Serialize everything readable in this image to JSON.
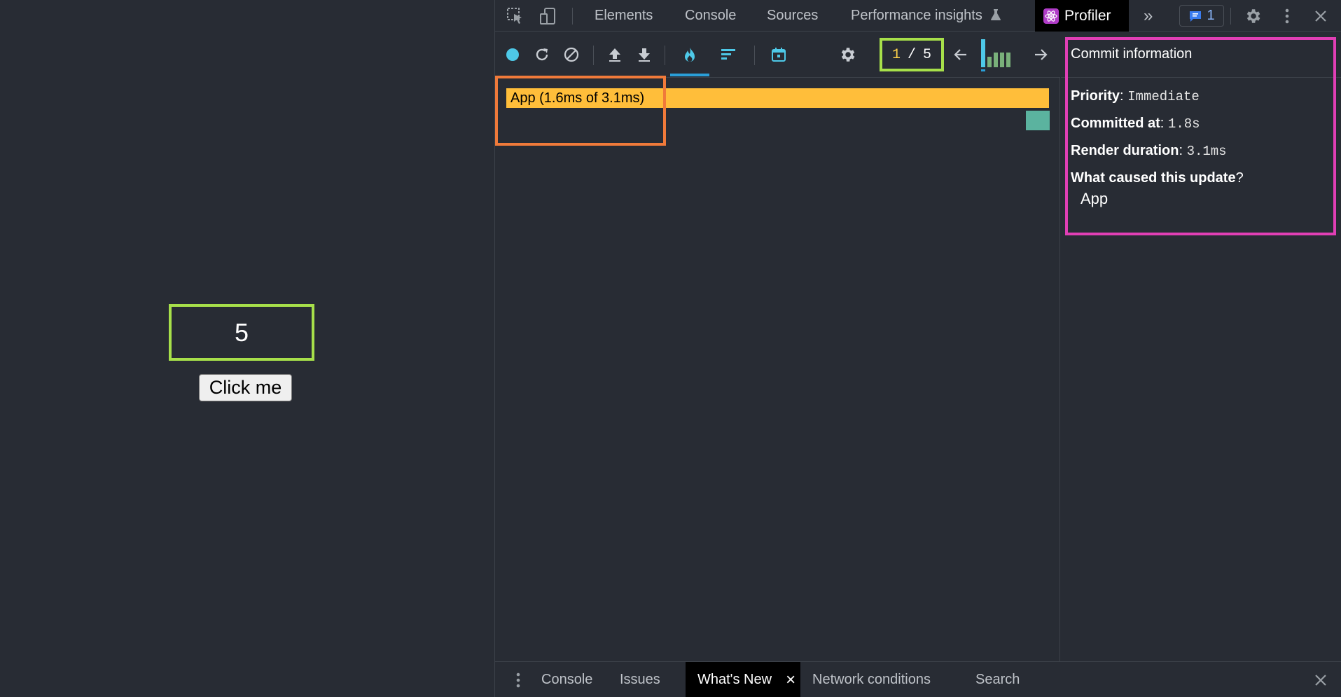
{
  "app": {
    "counter_value": "5",
    "button_label": "Click me"
  },
  "devtools": {
    "tabs": [
      "Elements",
      "Console",
      "Sources",
      "Performance insights"
    ],
    "active_tab": "Profiler",
    "more_tabs_glyph": "»",
    "issues_count": "1"
  },
  "profiler": {
    "commit_current": "1",
    "commit_separator": "/",
    "commit_total": "5",
    "commit_bars": [
      {
        "level": 1.0,
        "color": "#4ec9e8"
      },
      {
        "level": 0.38,
        "color": "#79b07a"
      },
      {
        "level": 0.52,
        "color": "#79b07a"
      },
      {
        "level": 0.52,
        "color": "#79b07a"
      },
      {
        "level": 0.52,
        "color": "#79b07a"
      }
    ],
    "flame": {
      "root_label": "App (1.6ms of 3.1ms)",
      "root_color": "#ffbe3a",
      "child_color": "#5bb39f"
    }
  },
  "commit_info": {
    "title": "Commit information",
    "priority_label": "Priority",
    "priority_value": "Immediate",
    "committed_label": "Committed at",
    "committed_value": "1.8s",
    "duration_label": "Render duration",
    "duration_value": "3.1ms",
    "cause_label": "What caused this update",
    "cause_value": "App"
  },
  "drawer": {
    "tabs": [
      "Console",
      "Issues",
      "What's New",
      "Network conditions",
      "Search"
    ],
    "close_glyph": "×"
  },
  "colors": {
    "highlight_green": "#a7e04a",
    "highlight_orange": "#f07a3a",
    "highlight_magenta": "#e13fb5"
  }
}
